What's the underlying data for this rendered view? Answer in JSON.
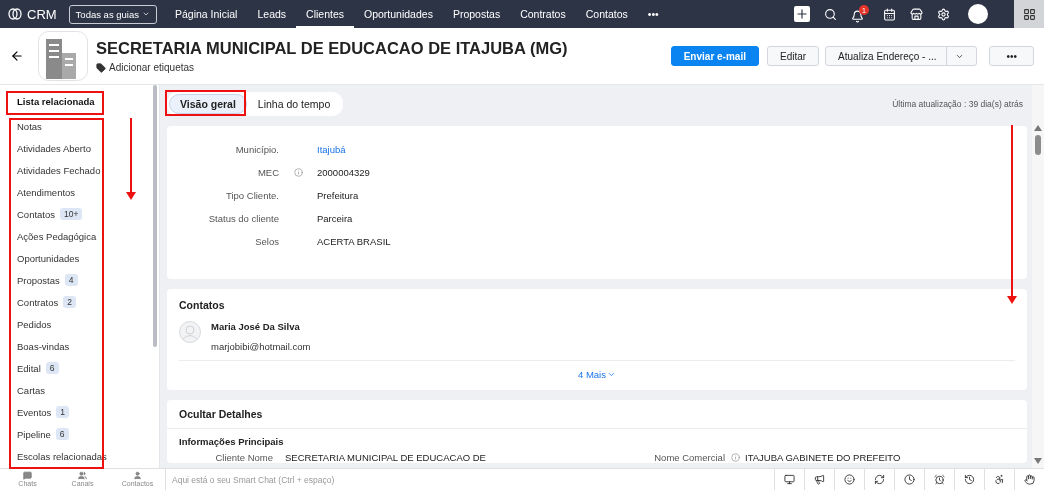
{
  "topnav": {
    "logo": "CRM",
    "module_menu": "Todas as guias",
    "more": "•••",
    "notification_count": "1",
    "items": [
      {
        "label": "Página Inicial",
        "selected": false
      },
      {
        "label": "Leads",
        "selected": false
      },
      {
        "label": "Clientes",
        "selected": true
      },
      {
        "label": "Oportunidades",
        "selected": false
      },
      {
        "label": "Propostas",
        "selected": false
      },
      {
        "label": "Contratos",
        "selected": false
      },
      {
        "label": "Contatos",
        "selected": false
      }
    ]
  },
  "header": {
    "title": "SECRETARIA MUNICIPAL DE EDUCACAO DE ITAJUBA (MG)",
    "tag_link": "Adicionar etiquetas",
    "buttons": [
      {
        "label": "Enviar e-mail",
        "kind": "primary"
      },
      {
        "label": "Editar",
        "kind": "default"
      },
      {
        "label": "Atualiza Endereço - ...",
        "kind": "split"
      },
      {
        "label": "•••",
        "kind": "default"
      }
    ]
  },
  "sidebar": {
    "title": "Lista relacionada",
    "items": [
      {
        "label": "Notas"
      },
      {
        "label": "Atividades Aberto"
      },
      {
        "label": "Atividades Fechado"
      },
      {
        "label": "Atendimentos"
      },
      {
        "label": "Contatos",
        "count": "10+"
      },
      {
        "label": "Ações Pedagógica"
      },
      {
        "label": "Oportunidades"
      },
      {
        "label": "Propostas",
        "count": "4"
      },
      {
        "label": "Contratos",
        "count": "2"
      },
      {
        "label": "Pedidos"
      },
      {
        "label": "Boas-vindas"
      },
      {
        "label": "Edital",
        "count": "6"
      },
      {
        "label": "Cartas"
      },
      {
        "label": "Eventos",
        "count": "1"
      },
      {
        "label": "Pipeline",
        "count": "6"
      },
      {
        "label": "Escolas relacionadas"
      }
    ]
  },
  "tabs": [
    {
      "label": "Visão geral",
      "selected": true
    },
    {
      "label": "Linha do tempo",
      "selected": false
    }
  ],
  "last_updated": "Última atualização : 39 dia(s) atrás",
  "overview_fields": [
    {
      "label": "Município.",
      "value": "Itajubá",
      "kind": "link",
      "info": false
    },
    {
      "label": "MEC",
      "value": "2000004329",
      "kind": "text",
      "info": true
    },
    {
      "label": "Tipo Cliente.",
      "value": "Prefeitura",
      "kind": "text",
      "info": false
    },
    {
      "label": "Status do cliente",
      "value": "Parceira",
      "kind": "text",
      "info": false
    },
    {
      "label": "Selos",
      "value": "ACERTA BRASIL",
      "kind": "text",
      "info": false
    }
  ],
  "contacts": {
    "title": "Contatos",
    "people": [
      {
        "name": "Maria José Da Silva",
        "email": "marjobibi@hotmail.com"
      }
    ],
    "more": "4 Mais"
  },
  "details": {
    "title": "Ocultar Detalhes",
    "section": "Informações Principais",
    "fields": [
      {
        "label": "Cliente Nome",
        "value": "SECRETARIA MUNICIPAL DE EDUCACAO DE",
        "info": false
      },
      {
        "label": "Nome Comercial",
        "value": "ITAJUBA GABINETE DO PREFEITO",
        "info": true
      }
    ]
  },
  "bottom_bar": {
    "channels": [
      {
        "label": "Chats",
        "kind": "chat"
      },
      {
        "label": "Canais",
        "kind": "group"
      },
      {
        "label": "Contactos",
        "kind": "person"
      }
    ],
    "placeholder": "Aqui está o seu Smart Chat (Ctrl + espaço)"
  }
}
